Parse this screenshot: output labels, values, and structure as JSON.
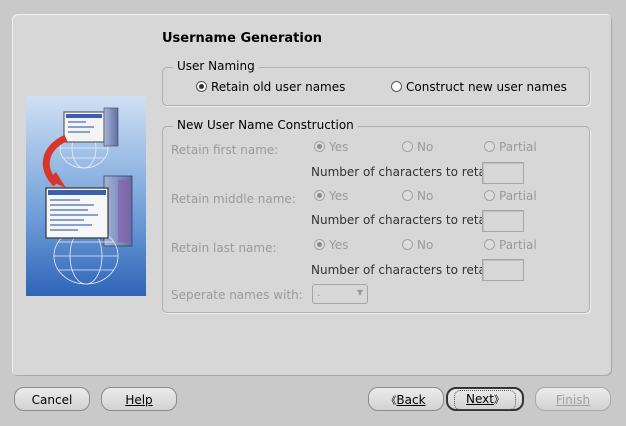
{
  "title": "Username Generation",
  "user_naming": {
    "legend": "User Naming",
    "options": [
      "Retain old user names",
      "Construct new user names"
    ],
    "selected": "Retain old user names"
  },
  "construction": {
    "legend": "New User Name Construction",
    "rows": [
      {
        "label": "Retain first name:",
        "options": [
          "Yes",
          "No",
          "Partial"
        ],
        "selected": "Yes",
        "chars_label": "Number of characters to retain:",
        "chars_value": ""
      },
      {
        "label": "Retain middle name:",
        "options": [
          "Yes",
          "No",
          "Partial"
        ],
        "selected": "Yes",
        "chars_label": "Number of characters to retain:",
        "chars_value": ""
      },
      {
        "label": "Retain last name:",
        "options": [
          "Yes",
          "No",
          "Partial"
        ],
        "selected": "Yes",
        "chars_label": "Number of characters to retain:",
        "chars_value": ""
      }
    ],
    "separator_label": "Seperate names with:",
    "separator_value": "."
  },
  "buttons": {
    "cancel": "Cancel",
    "help": "Help",
    "back": "Back",
    "next": "Next",
    "finish": "Finish",
    "back_arrow": "《",
    "next_arrow": "》"
  },
  "colors": {
    "window_bg": "#c9c9c9",
    "panel_bg": "#d7d7d7",
    "disabled_text": "#9a9a9a"
  }
}
